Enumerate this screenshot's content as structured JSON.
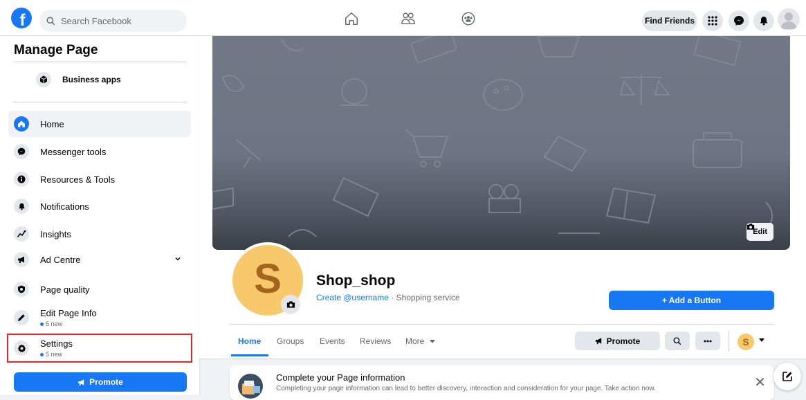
{
  "topbar": {
    "search_placeholder": "Search Facebook",
    "find_friends": "Find Friends",
    "brand_color": "#1877f2"
  },
  "sidebar": {
    "title": "Manage Page",
    "business_apps": "Business apps",
    "items": [
      {
        "label": "Home",
        "icon": "home-icon",
        "active": true
      },
      {
        "label": "Messenger tools",
        "icon": "messenger-icon"
      },
      {
        "label": "Resources & Tools",
        "icon": "info-icon"
      },
      {
        "label": "Notifications",
        "icon": "bell-icon"
      },
      {
        "label": "Insights",
        "icon": "insights-icon"
      },
      {
        "label": "Ad Centre",
        "icon": "megaphone-icon"
      },
      {
        "label": "Page quality",
        "icon": "shield-icon"
      },
      {
        "label": "Edit Page Info",
        "icon": "pencil-icon",
        "sub": "5 new"
      },
      {
        "label": "Settings",
        "icon": "gear-icon",
        "sub": "5 new"
      }
    ],
    "promote": "Promote"
  },
  "page": {
    "avatar_letter": "S",
    "name": "Shop_shop",
    "username_link": "Create @username",
    "category": " · Shopping service",
    "edit_cover": "Edit",
    "add_button": "+ Add a Button",
    "tabs": [
      "Home",
      "Groups",
      "Events",
      "Reviews",
      "More"
    ],
    "promote": "Promote",
    "mini_avatar": "S"
  },
  "info_card": {
    "title": "Complete your Page information",
    "description": "Completing your page information can lead to better discovery, interaction and consideration for your page. Take action now."
  }
}
